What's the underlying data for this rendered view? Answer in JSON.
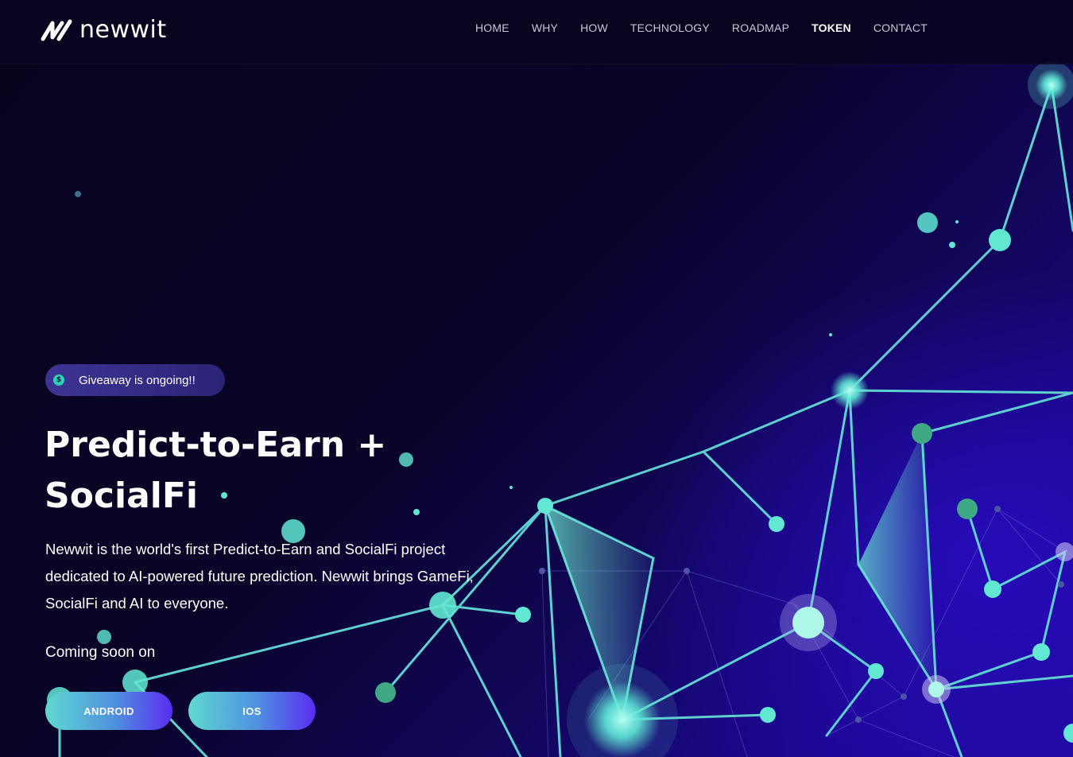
{
  "brand": {
    "name": "newwit"
  },
  "nav": {
    "items": [
      {
        "label": "HOME",
        "active": false
      },
      {
        "label": "WHY",
        "active": false
      },
      {
        "label": "HOW",
        "active": false
      },
      {
        "label": "TECHNOLOGY",
        "active": false
      },
      {
        "label": "ROADMAP",
        "active": false
      },
      {
        "label": "TOKEN",
        "active": true
      },
      {
        "label": "CONTACT",
        "active": false
      }
    ]
  },
  "hero": {
    "badge": {
      "icon": "dollar-coin-icon",
      "icon_glyph": "$",
      "text": "Giveaway is ongoing!!"
    },
    "title_line1": "Predict-to-Earn +",
    "title_line2": "SocialFi",
    "description": "Newwit is the world's first Predict-to-Earn and SocialFi project dedicated to AI-powered future prediction. Newwit brings GameFi, SocialFi and AI to everyone.",
    "coming_soon": "Coming soon on",
    "buttons": {
      "android": "ANDROID",
      "ios": "IOS"
    }
  },
  "colors": {
    "background": "#07031e",
    "accent_teal": "#5fe8d6",
    "accent_violet": "#5a2cf0"
  }
}
